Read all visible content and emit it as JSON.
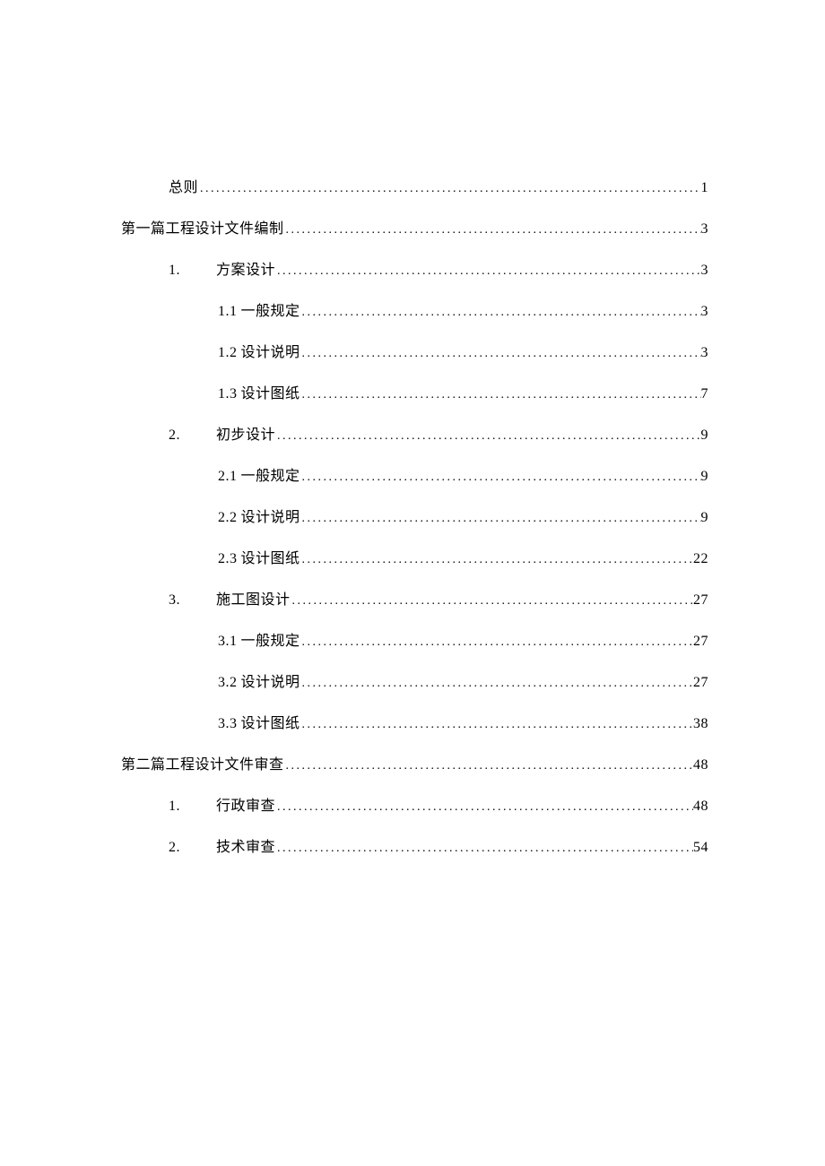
{
  "toc": [
    {
      "level": 0,
      "num": "",
      "label": "总则",
      "page": "1"
    },
    {
      "level": 1,
      "num": "",
      "label": "第一篇工程设计文件编制",
      "page": "3"
    },
    {
      "level": 2,
      "num": "1.",
      "label": "方案设计",
      "page": "3"
    },
    {
      "level": 3,
      "num": "1.1",
      "label": "一般规定",
      "page": "3"
    },
    {
      "level": 3,
      "num": "1.2",
      "label": "设计说明",
      "page": "3"
    },
    {
      "level": 3,
      "num": "1.3",
      "label": "设计图纸",
      "page": "7"
    },
    {
      "level": 2,
      "num": "2.",
      "label": "初步设计",
      "page": "9"
    },
    {
      "level": 3,
      "num": "2.1",
      "label": "一般规定",
      "page": "9"
    },
    {
      "level": 3,
      "num": "2.2",
      "label": "设计说明",
      "page": "9"
    },
    {
      "level": 3,
      "num": "2.3",
      "label": "设计图纸",
      "page": "22"
    },
    {
      "level": 2,
      "num": "3.",
      "label": "施工图设计",
      "page": "27"
    },
    {
      "level": 3,
      "num": "3.1",
      "label": "一般规定",
      "page": "27"
    },
    {
      "level": 3,
      "num": "3.2",
      "label": "设计说明",
      "page": "27"
    },
    {
      "level": 3,
      "num": "3.3",
      "label": "设计图纸",
      "page": "38"
    },
    {
      "level": 1,
      "num": "",
      "label": "第二篇工程设计文件审查",
      "page": "48"
    },
    {
      "level": 2,
      "num": "1.",
      "label": "行政审查",
      "page": "48"
    },
    {
      "level": 2,
      "num": "2.",
      "label": "技术审查",
      "page": "54"
    }
  ]
}
